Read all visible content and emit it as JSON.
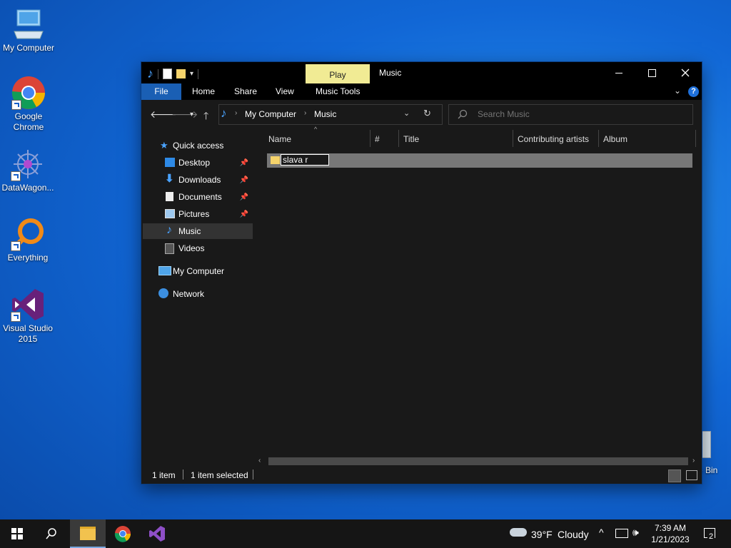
{
  "desktop": {
    "icons": [
      {
        "label": "My Computer",
        "icon": "computer-icon"
      },
      {
        "label": "Google Chrome",
        "icon": "chrome-icon"
      },
      {
        "label": "DataWagon...",
        "icon": "datawagon-icon"
      },
      {
        "label": "Everything",
        "icon": "everything-search-icon"
      },
      {
        "label": "Visual Studio 2015",
        "icon": "visual-studio-icon"
      },
      {
        "label": "e Bin",
        "icon": "recycle-bin-icon"
      }
    ]
  },
  "window": {
    "title": "Music",
    "contextual_tab": "Play",
    "ribbon_tabs": [
      "File",
      "Home",
      "Share",
      "View",
      "Music Tools"
    ],
    "breadcrumb": [
      "My Computer",
      "Music"
    ],
    "search_placeholder": "Search Music",
    "columns": [
      "Name",
      "#",
      "Title",
      "Contributing artists",
      "Album"
    ],
    "rename_value": "slava r",
    "nav": {
      "quick_access": "Quick access",
      "items": [
        {
          "label": "Desktop",
          "pinned": true
        },
        {
          "label": "Downloads",
          "pinned": true
        },
        {
          "label": "Documents",
          "pinned": true
        },
        {
          "label": "Pictures",
          "pinned": true
        },
        {
          "label": "Music",
          "pinned": false,
          "selected": true
        },
        {
          "label": "Videos",
          "pinned": false
        }
      ],
      "my_computer": "My Computer",
      "network": "Network"
    },
    "status": {
      "count": "1 item",
      "selected": "1 item selected"
    }
  },
  "taskbar": {
    "weather_temp": "39°F",
    "weather_desc": "Cloudy",
    "time": "7:39 AM",
    "date": "1/21/2023",
    "notifications": "2"
  },
  "colors": {
    "accent": "#1a5fb4",
    "context_tab": "#f1eb94",
    "window_bg": "#191919"
  }
}
